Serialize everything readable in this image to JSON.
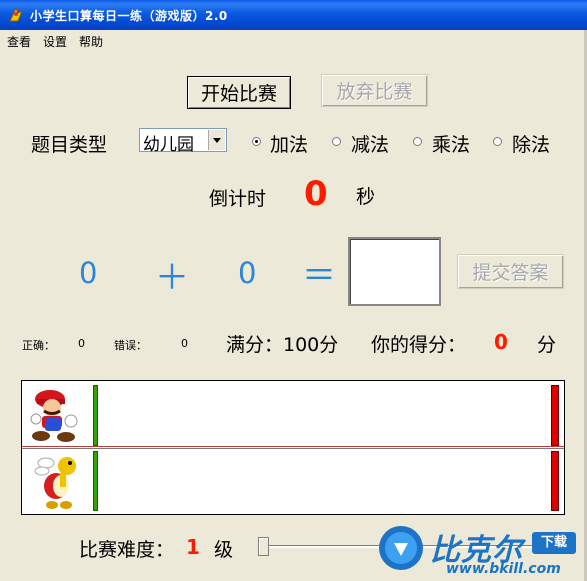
{
  "window": {
    "title": "小学生口算每日一练（游戏版）2.0"
  },
  "menu": [
    "查看",
    "设置",
    "帮助"
  ],
  "buttons": {
    "start": "开始比赛",
    "give_up": "放弃比赛",
    "submit": "提交答案"
  },
  "question_type": {
    "label": "题目类型",
    "selected_level": "幼儿园",
    "operations": [
      {
        "label": "加法",
        "checked": true
      },
      {
        "label": "减法",
        "checked": false
      },
      {
        "label": "乘法",
        "checked": false
      },
      {
        "label": "除法",
        "checked": false
      }
    ]
  },
  "countdown": {
    "label": "倒计时",
    "value": "0",
    "unit": "秒"
  },
  "equation": {
    "operand1": "0",
    "operator": "＋",
    "operand2": "0",
    "equals": "＝",
    "answer": ""
  },
  "stats": {
    "correct_label": "正确：",
    "correct": "0",
    "wrong_label": "错误：",
    "wrong": "0",
    "full_score_label": "满分：100分",
    "your_score_label": "你的得分：",
    "your_score": "0",
    "score_unit": "分"
  },
  "difficulty": {
    "label": "比赛难度：",
    "level": "1",
    "unit": "级"
  },
  "watermark": {
    "brand": "比克尔",
    "badge": "下载",
    "url": "www.bkill.com"
  },
  "colors": {
    "titlebar": "#0054e3",
    "accent_blue": "#2b86d6",
    "score_red": "#ff1b00",
    "track_green": "#33a300",
    "track_red": "#e00000"
  },
  "icons": [
    "mario-character-icon",
    "koopa-character-icon",
    "app-icon"
  ]
}
